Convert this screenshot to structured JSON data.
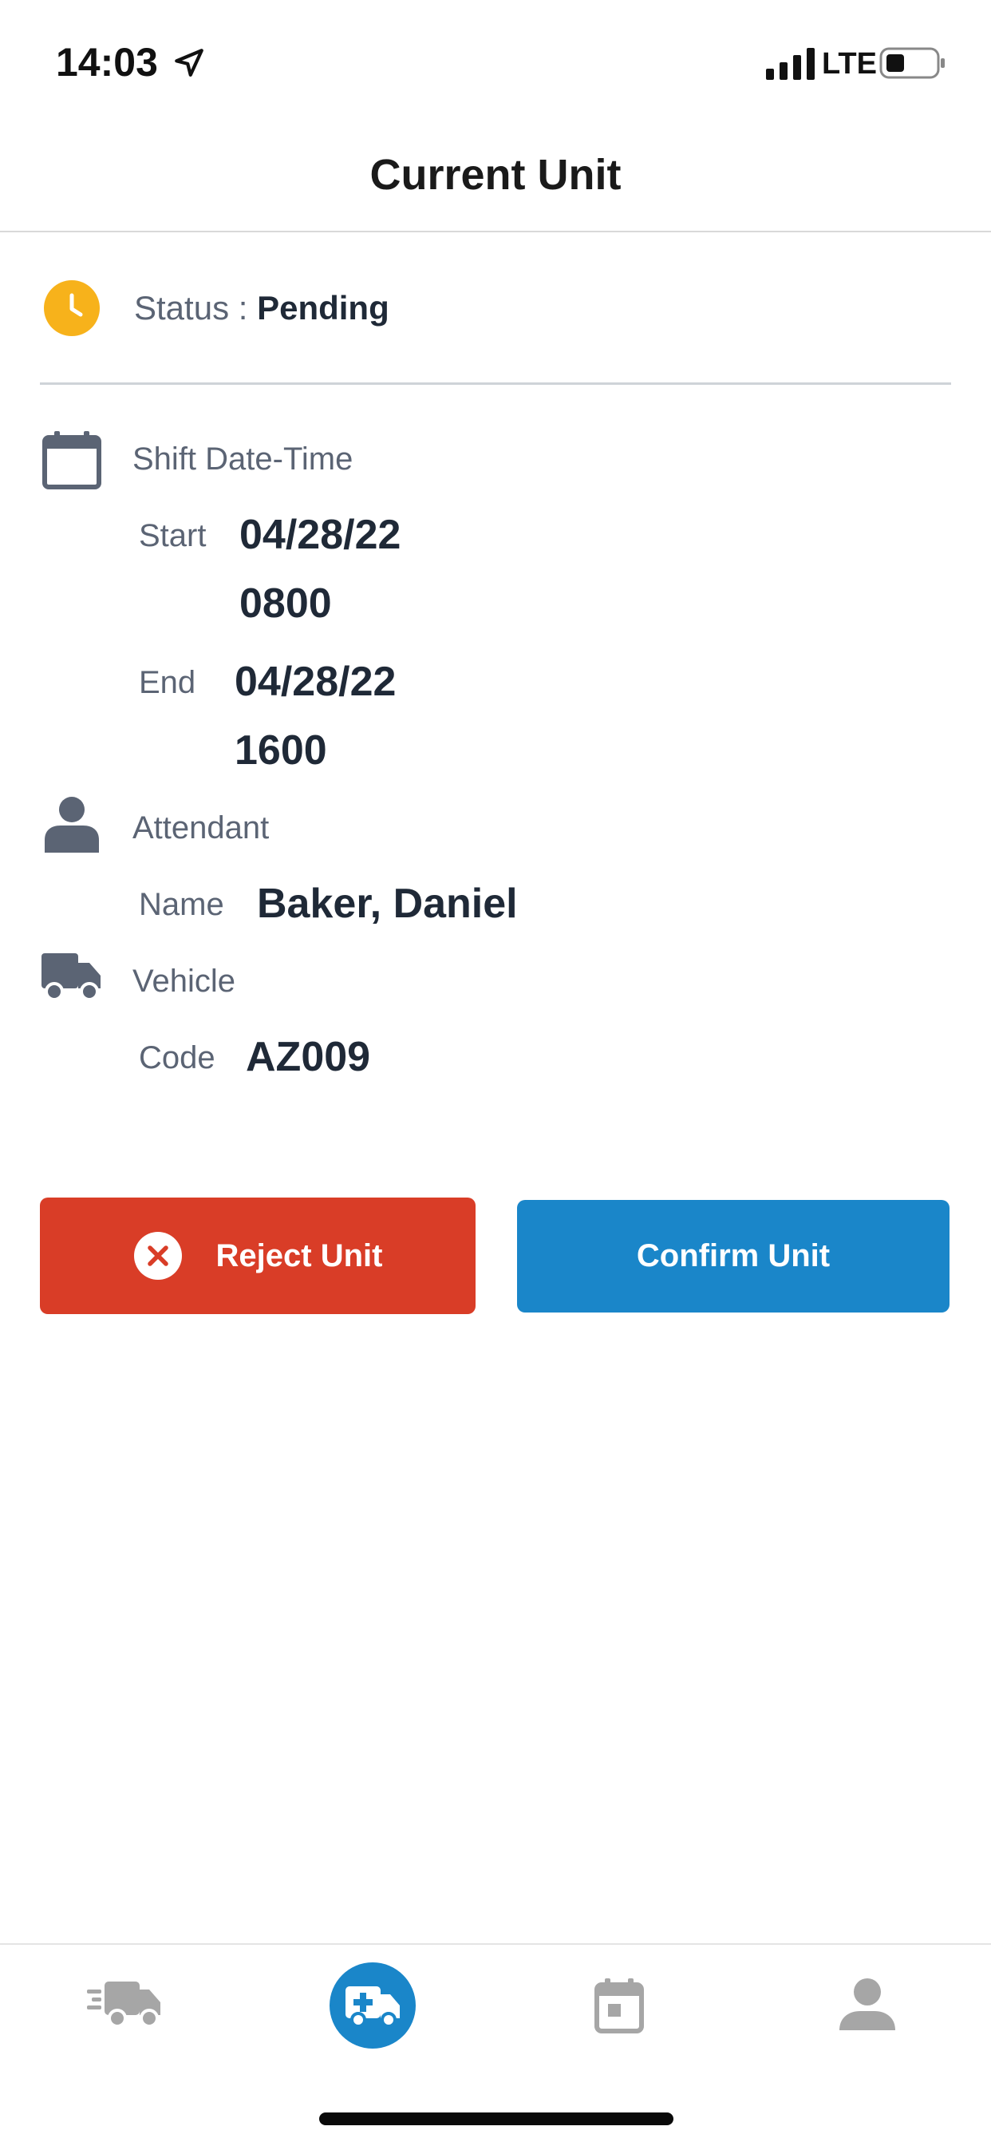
{
  "status_bar": {
    "time": "14:03",
    "network": "LTE"
  },
  "header": {
    "title": "Current Unit"
  },
  "status": {
    "label": "Status : ",
    "value": "Pending",
    "icon": "clock-icon",
    "color": "#f7b21b"
  },
  "shift": {
    "title": "Shift Date-Time",
    "icon": "calendar-icon",
    "start_label": "Start",
    "start_date": "04/28/22",
    "start_time": "0800",
    "end_label": "End",
    "end_date": "04/28/22",
    "end_time": "1600"
  },
  "attendant": {
    "title": "Attendant",
    "icon": "person-icon",
    "name_label": "Name",
    "name_value": "Baker, Daniel"
  },
  "vehicle": {
    "title": "Vehicle",
    "icon": "truck-icon",
    "code_label": "Code",
    "code_value": "AZ009"
  },
  "actions": {
    "reject_label": "Reject Unit",
    "confirm_label": "Confirm Unit",
    "reject_color": "#d93d27",
    "confirm_color": "#1a86c9"
  },
  "bottom_nav": {
    "items": [
      {
        "icon": "truck-fast-icon",
        "active": false
      },
      {
        "icon": "ambulance-icon",
        "active": true
      },
      {
        "icon": "calendar-day-icon",
        "active": false
      },
      {
        "icon": "profile-icon",
        "active": false
      }
    ],
    "active_color": "#1a86c9",
    "inactive_color": "#a6a6a6"
  }
}
